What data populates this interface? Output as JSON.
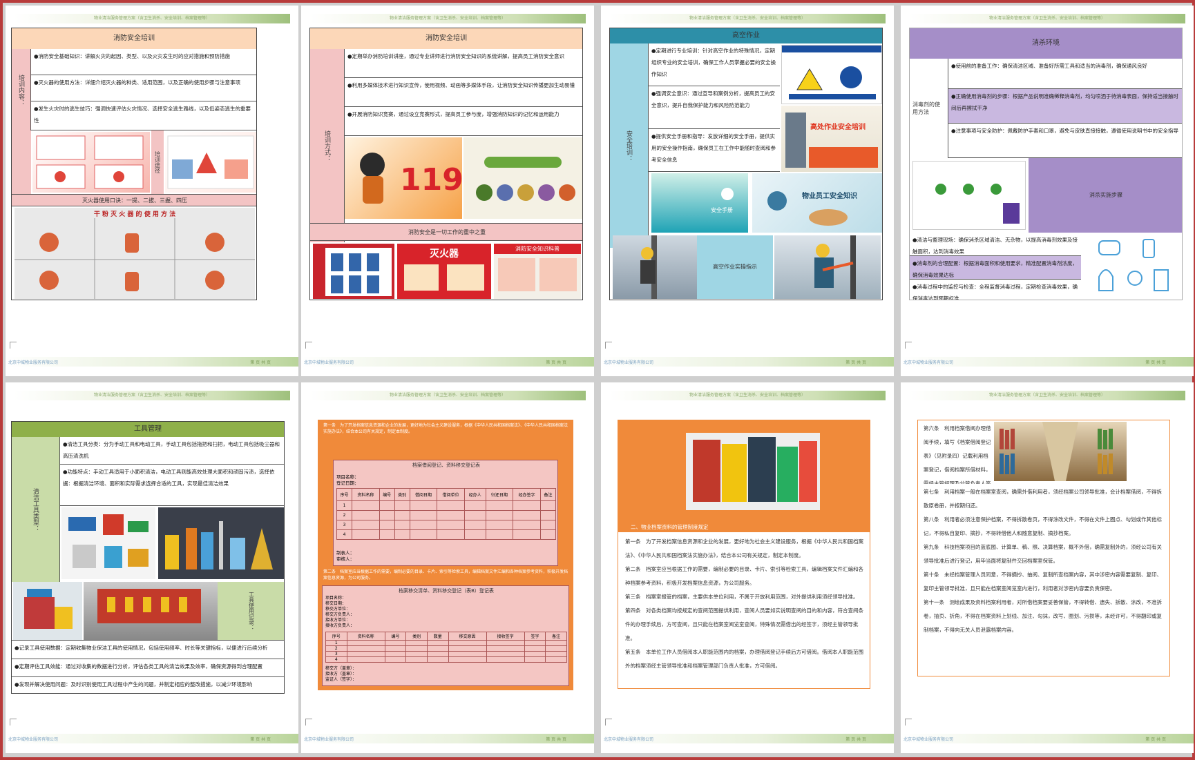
{
  "pages": {
    "p1": {
      "title": "消防安全培训",
      "side_label": "培训内容：",
      "rows": [
        "●消防安全基础知识：讲解火灾的起因、类型、以及火灾发生时的应对措施和预防措施",
        "●灭火器的使用方法：详细介绍灭火器的种类、适用范围，以及正确的使用步骤与注意事项",
        "●发生火灾时的逃生技巧：强调快速评估火灾情况、选择安全逃生路线，以及低姿态逃生的重要性"
      ],
      "side2": "培训途径",
      "caption": "灭火器使用口诀：一提、二拔、三握、四压",
      "poster_title": "干 粉 灭 火 器 的 使 用 方 法"
    },
    "p2": {
      "title": "消防安全培训",
      "side_label": "培训方式：",
      "rows": [
        "●定期举办消防培训讲座，通过专业讲师进行消防安全知识的系统讲解，提高员工消防安全意识",
        "●利用多媒体技术进行知识宣传，使用视频、动画等多媒体手段，让消防安全知识传播更加生动易懂",
        "●开展消防知识竞赛，通过设立竞赛形式，提高员工参与度，增强消防知识的记忆和运用能力"
      ],
      "number": "119",
      "slogan": "消防安全是一切工作的重中之重",
      "poster_fire": "灭火器",
      "poster_knowledge": "消防安全知识科普"
    },
    "p3": {
      "title": "高空作业",
      "side_label": "安全培训：",
      "rows": [
        "●定期进行专业培训：针对高空作业的特殊情况，定期组织专业的安全培训，确保工作人员掌握必要的安全操作知识",
        "●强调安全意识：通过宣导和案例分析，提高员工的安全意识，提升自我保护能力和风险防范能力",
        "●提供安全手册和指导：发放详细的安全手册，提供实用的安全操作指南，确保员工在工作中能随时查阅和参考安全信息"
      ],
      "banner": "高处作业安全培训",
      "manual": "安全手册",
      "knowledge": "物业员工安全知识",
      "caption": "高空作业实操指示"
    },
    "p4": {
      "title": "消杀环境",
      "side_label": "消毒剂的使用方法",
      "rows": [
        "●使用前的准备工作：确保清洁区域、准备好所需工具和适当的消毒剂，确保通风良好",
        "●正确使用消毒剂的步骤：根据产品说明准确稀释消毒剂，均匀喷洒于待消毒表面，保持适当接触时间后再擦拭干净",
        "●注意事项与安全防护：佩戴防护手套和口罩，避免与皮肤直接接触，遵循使用说明书中的安全指导"
      ],
      "right_label": "消杀实施步骤",
      "bottom_rows": [
        "●清洁与整理现场：确保消杀区域清洁、无杂物，以提高消毒剂效果及接触面积，达到消毒效果",
        "●消毒剂的合理配置：根据消毒面积和使用要求，精准配置消毒剂浓度，确保消毒效果达标",
        "●消毒过程中的监控与检查：全程监督消毒过程，定期检查消毒效果，确保消毒达到预期标准"
      ]
    },
    "p5": {
      "title": "工具管理",
      "side_label": "清洁工具类型：",
      "rows": [
        "●清洁工具分类：分为手动工具和电动工具，手动工具包括拖把和扫把，电动工具包括吸尘器和高压清洗机",
        "●功能特点：手动工具适用于小面积清洁，电动工具则能高效处理大面积和顽固污渍，选择依据：根据清洁环境、面积和实际需求选择合适的工具，实现最佳清洁效果"
      ],
      "right_label": "工具使用记录：",
      "bottom_rows": [
        "●记录工具使用数据：定期收集物业保洁工具的使用情况，包括使用频率、时长等关键指标，以便进行后续分析",
        "●定期评估工具效能：通过对收集的数据进行分析，评估各类工具的清洁效果及效率，确保资源得到合理配置",
        "●发现并解决使用问题：及时识别使用工具过程中产生的问题，并制定相应的整改措施，以减少环境影响"
      ]
    },
    "p6": {
      "form1_title": "档案借阅登记、资料移交登记表",
      "form1_fields": [
        "项目名称：",
        "登记日期："
      ],
      "form1_headers": [
        "序号",
        "资料名称",
        "编号",
        "类别",
        "借阅日期",
        "借阅单位",
        "经办人",
        "归还日期",
        "经办签字",
        "备注"
      ],
      "form1_rows": [
        "1",
        "2",
        "3",
        "4"
      ],
      "form1_footer": [
        "制表人：",
        "审核人："
      ],
      "form2_title": "档案移交清单、资料移交登记（表B）登记表",
      "form2_fields": [
        "项目名称：",
        "移交日期：",
        "移交方单位：",
        "移交方负责人：",
        "接收方单位：",
        "接收方负责人："
      ],
      "form2_headers": [
        "序号",
        "资料名称",
        "编号",
        "类别",
        "数量",
        "移交原因",
        "接收签字",
        "签字",
        "备注"
      ],
      "form2_rows": [
        "1",
        "2",
        "3",
        "4"
      ],
      "form2_footer": [
        "移交方（盖章）：",
        "接收方（盖章）：",
        "监证人（签字）："
      ]
    },
    "p7": {
      "heading": "二、物业档案资料的管理制度规定",
      "paragraphs": [
        "第一条　为了开发档案信息资源和企业的发展，更好地为社会主义建设服务，根据《中华人民共和国档案法》、《中华人民共和国档案法实施办法》，结合本公司有关规定，制定本制度。",
        "第二条　档案室应当根据工作的需要，编制必要的目录、卡片、索引等检索工具，编辑档案文件汇编和各种档案参考资料，积极开发档案信息资源，为公司服务。",
        "第三条　档案室报管的档案，主要供本单位利用，不属于开放利用范围，对外提供利用须经领导批准。",
        "第四条　对各类档案均按规定的查阅范围提供利用，查阅人员要如实说明查阅的目的和内容，符合查阅条件的办理手续后，方可查阅，且只能在档案室阅览室查阅，特殊情况需借出的经签字，须经主管领导批准。",
        "第五条　本单位工作人员借阅本人职能范围内的档案，办理借阅登记手续后方可借阅。借阅本人职能范围外的档案须经主管领导批准和档案管理部门负责人批准，方可借阅。"
      ]
    },
    "p8": {
      "paragraphs": [
        "第六条　利用档案借阅办理借阅手续，填写《档案借阅登记表》（见附录四）记载利用档案登记，借阅档案所借材料，需经主管经理及分管负责人签字批准后方可借阅（见附录五）。",
        "第七条　利用档案一般在档案室查阅，确需外借利用者，须经档案公司领导批准，会计档案借阅，不得拆散原卷册，并按期归还。",
        "第八条　利用者必须注意保护档案，不得拆散卷页，不得涂改文件，不得在文件上圈点、勾划或作其他标记，不得私自复印、摘抄，不得转借他人和随意复制、摘抄档案。",
        "第九条　科技档案项目的蓝底图、计算单、稿、照、决算档案，概不外借，确需复制外的，须经公司有关领导批准后进行登记，用毕当面将复制件交回档案室保管。",
        "第十条　未经档案管理人员同意，不得摘抄、抽阅、复制所查档案内容，其中涉密内容需要复制、复印、复印主管领导批准，且只能在档案室阅览室内进行，利用者对涉密内容要负责保密。",
        "第十一条　测绘成果及资料档案利用者，对所借档案要妥善保管，不得转借、遗失、拆散、涂改，不准拆卷，抽页、折角，不得在档案资料上划线、加注、勾抹，改写、圈划、污损等，未经许可，不得翻印或复制档案，不得向无关人员泄露档案内容。"
      ]
    },
    "footer_left": "北京中城物业服务有限公司",
    "footer_right": "第 页 共 页",
    "header_text": "物业清洁服务管理方案（含卫生消杀、安全培训、档案管理等）"
  }
}
